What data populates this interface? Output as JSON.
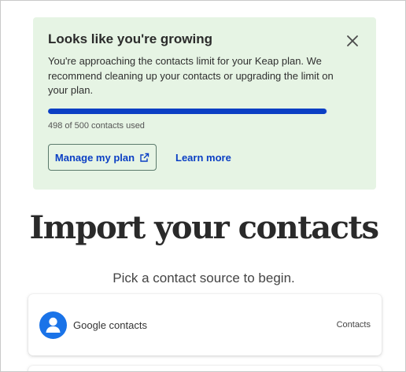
{
  "banner": {
    "title": "Looks like you're growing",
    "message": "You're approaching the contacts limit for your Keap plan. We recommend cleaning up your contacts or upgrading the limit on your plan.",
    "usage_label": "498 of 500 contacts used",
    "contacts_used": 498,
    "contacts_limit": 500,
    "close_icon": "close-icon",
    "manage_button": "Manage my plan",
    "manage_icon": "external-link-icon",
    "learn_more": "Learn more",
    "colors": {
      "background": "#e6f4e4",
      "accent": "#0b3fc4"
    }
  },
  "main": {
    "title": "Import your contacts",
    "subtitle": "Pick a contact source to begin."
  },
  "sources": [
    {
      "name": "Google contacts",
      "tag": "Contacts",
      "icon": "person-icon",
      "icon_color": "#1a73e8"
    }
  ]
}
